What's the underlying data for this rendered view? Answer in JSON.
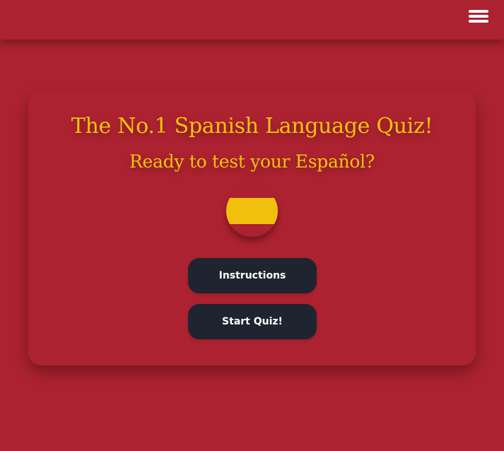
{
  "header": {
    "menu_icon": "hamburger-menu-icon"
  },
  "card": {
    "title": "The No.1 Spanish Language Quiz!",
    "subtitle": "Ready to test your Español?",
    "flag_icon": "spain-flag-icon",
    "buttons": {
      "instructions": "Instructions",
      "start_quiz": "Start Quiz!"
    }
  },
  "colors": {
    "background": "#ad2230",
    "accent_text": "#f4c20d",
    "button_bg": "#1e2530",
    "button_text": "#ffffff",
    "flag_red": "#ad2230",
    "flag_yellow": "#f1c00f"
  }
}
